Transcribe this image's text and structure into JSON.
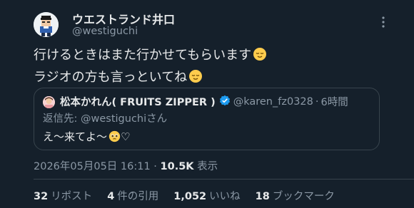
{
  "author": {
    "display_name": "ウエストランド井口",
    "handle": "@westiguchi"
  },
  "tweet": {
    "line1": "行けるときはまた行かせてもらいます",
    "line2": "ラジオの方も言っといてね",
    "emoji": "relieved-face"
  },
  "quoted": {
    "name": "松本かれん( FRUITS ZIPPER )",
    "handle": "@karen_fz0328",
    "separator": "·",
    "time": "6時間",
    "reply_prefix": "返信先: ",
    "reply_to": "@westiguchi",
    "reply_suffix": "さん",
    "text": "え〜来てよ〜",
    "text_tail": "♡",
    "verified_color": "#1d9bf0"
  },
  "meta": {
    "timestamp": "2026年05月05日 16:11",
    "separator": " · ",
    "views": "10.5K",
    "views_label": " 表示"
  },
  "stats": [
    {
      "num": "32",
      "label": "リポスト"
    },
    {
      "num": "4",
      "label": "件の引用"
    },
    {
      "num": "1,052",
      "label": "いいね"
    },
    {
      "num": "18",
      "label": "ブックマーク"
    }
  ]
}
